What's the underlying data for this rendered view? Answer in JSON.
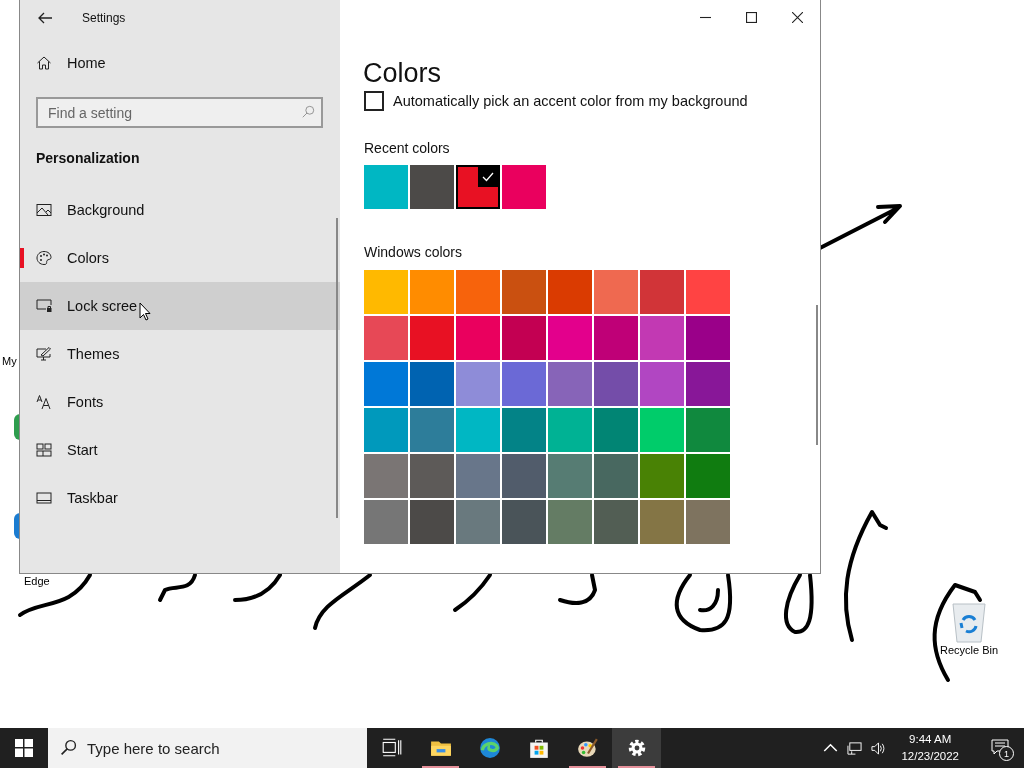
{
  "window": {
    "title": "Settings"
  },
  "sidebar": {
    "home": "Home",
    "search": {
      "placeholder": "Find a setting"
    },
    "section": "Personalization",
    "items": [
      {
        "label": "Background",
        "kind": "background",
        "selected": false,
        "hovered": false
      },
      {
        "label": "Colors",
        "kind": "colors",
        "selected": true,
        "hovered": false
      },
      {
        "label": "Lock scree",
        "kind": "lock",
        "selected": false,
        "hovered": true
      },
      {
        "label": "Themes",
        "kind": "themes",
        "selected": false,
        "hovered": false
      },
      {
        "label": "Fonts",
        "kind": "fonts",
        "selected": false,
        "hovered": false
      },
      {
        "label": "Start",
        "kind": "start",
        "selected": false,
        "hovered": false
      },
      {
        "label": "Taskbar",
        "kind": "taskbar",
        "selected": false,
        "hovered": false
      }
    ]
  },
  "content": {
    "heading": "Colors",
    "auto_pick": {
      "label": "Automatically pick an accent color from my background",
      "checked": false
    },
    "recent": {
      "title": "Recent colors",
      "colors": [
        {
          "color": "#00b7c3",
          "selected": false
        },
        {
          "color": "#4c4a48",
          "selected": false
        },
        {
          "color": "#e81123",
          "selected": true
        },
        {
          "color": "#ea005e",
          "selected": false
        }
      ]
    },
    "windows_colors": {
      "title": "Windows colors",
      "colors": [
        {
          "color": "#ffb900",
          "selected": false
        },
        {
          "color": "#ff8c00",
          "selected": false
        },
        {
          "color": "#f7630c",
          "selected": false
        },
        {
          "color": "#ca5010",
          "selected": false
        },
        {
          "color": "#da3b01",
          "selected": false
        },
        {
          "color": "#ef6950",
          "selected": false
        },
        {
          "color": "#d13438",
          "selected": false
        },
        {
          "color": "#ff4343",
          "selected": false
        },
        {
          "color": "#e74856",
          "selected": false
        },
        {
          "color": "#e81123",
          "selected": false
        },
        {
          "color": "#ea005e",
          "selected": false
        },
        {
          "color": "#c30052",
          "selected": false
        },
        {
          "color": "#e3008c",
          "selected": false
        },
        {
          "color": "#bf0077",
          "selected": false
        },
        {
          "color": "#c239b3",
          "selected": false
        },
        {
          "color": "#9a0089",
          "selected": false
        },
        {
          "color": "#0078d7",
          "selected": false
        },
        {
          "color": "#0063b1",
          "selected": false
        },
        {
          "color": "#8e8cd8",
          "selected": false
        },
        {
          "color": "#6b69d6",
          "selected": false
        },
        {
          "color": "#8764b8",
          "selected": false
        },
        {
          "color": "#744da9",
          "selected": false
        },
        {
          "color": "#b146c2",
          "selected": false
        },
        {
          "color": "#881798",
          "selected": false
        },
        {
          "color": "#0099bc",
          "selected": false
        },
        {
          "color": "#2d7d9a",
          "selected": false
        },
        {
          "color": "#00b7c3",
          "selected": false
        },
        {
          "color": "#038387",
          "selected": false
        },
        {
          "color": "#00b294",
          "selected": false
        },
        {
          "color": "#018574",
          "selected": false
        },
        {
          "color": "#00cc6a",
          "selected": false
        },
        {
          "color": "#10893e",
          "selected": false
        },
        {
          "color": "#7a7574",
          "selected": false
        },
        {
          "color": "#5d5a58",
          "selected": false
        },
        {
          "color": "#68768a",
          "selected": false
        },
        {
          "color": "#515c6b",
          "selected": false
        },
        {
          "color": "#567c73",
          "selected": false
        },
        {
          "color": "#486860",
          "selected": false
        },
        {
          "color": "#498205",
          "selected": false
        },
        {
          "color": "#107c10",
          "selected": false
        },
        {
          "color": "#767676",
          "selected": false
        },
        {
          "color": "#4c4a48",
          "selected": false
        },
        {
          "color": "#69797e",
          "selected": false
        },
        {
          "color": "#4a5459",
          "selected": false
        },
        {
          "color": "#647c64",
          "selected": false
        },
        {
          "color": "#525e54",
          "selected": false
        },
        {
          "color": "#847545",
          "selected": false
        },
        {
          "color": "#7e735f",
          "selected": false
        }
      ]
    }
  },
  "desktop": {
    "icons": [
      {
        "label": "My",
        "kind": "partial-green"
      },
      {
        "label": "Edge",
        "kind": "partial-blue"
      },
      {
        "label": "Recycle Bin",
        "kind": "recycle"
      }
    ]
  },
  "taskbar": {
    "search": {
      "placeholder": "Type here to search"
    },
    "apps": [
      {
        "kind": "taskview",
        "running": false,
        "active": false
      },
      {
        "kind": "explorer",
        "running": true,
        "active": false
      },
      {
        "kind": "edge",
        "running": false,
        "active": false
      },
      {
        "kind": "store",
        "running": false,
        "active": false
      },
      {
        "kind": "paint",
        "running": true,
        "active": false
      },
      {
        "kind": "settings",
        "running": true,
        "active": true
      }
    ],
    "time": "9:44 AM",
    "date": "12/23/2022",
    "notifications": "1"
  }
}
